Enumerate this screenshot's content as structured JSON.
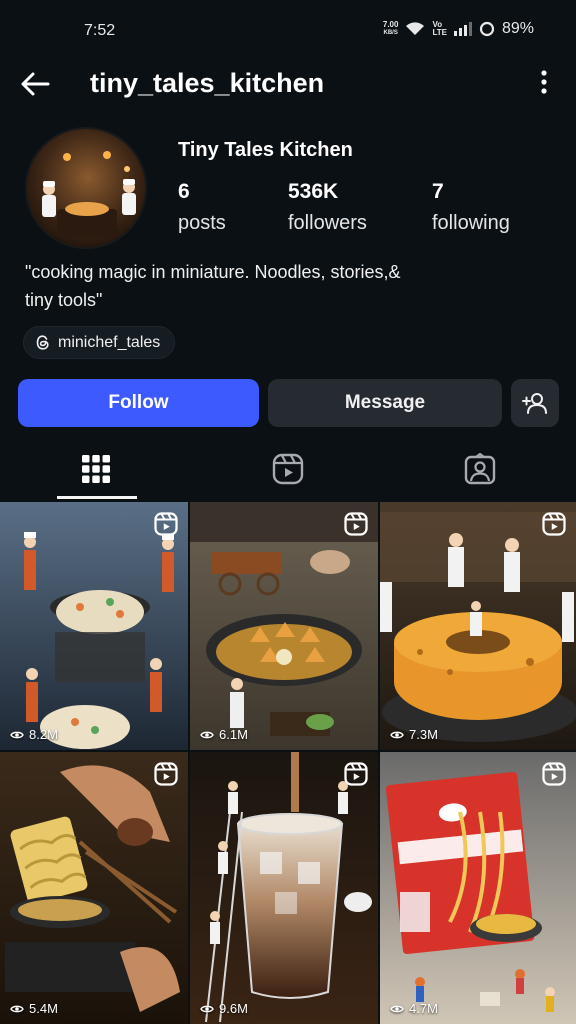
{
  "status_bar": {
    "time": "7:52",
    "net_speed_value": "7.00",
    "net_speed_unit": "KB/S",
    "volte_top": "Vo",
    "volte_bottom": "LTE",
    "battery": "89%"
  },
  "header": {
    "username": "tiny_tales_kitchen"
  },
  "profile": {
    "display_name": "Tiny Tales Kitchen",
    "stats": [
      {
        "value": "6",
        "label": "posts"
      },
      {
        "value": "536K",
        "label": "followers"
      },
      {
        "value": "7",
        "label": "following"
      }
    ],
    "bio_line1": "\"cooking magic in miniature. Noodles, stories,&",
    "bio_line2": "tiny tools\"",
    "threads_handle": "minichef_tales"
  },
  "actions": {
    "follow_label": "Follow",
    "message_label": "Message"
  },
  "tabs": [
    {
      "name": "grid-icon",
      "active": true
    },
    {
      "name": "reels-icon",
      "active": false
    },
    {
      "name": "tagged-icon",
      "active": false
    }
  ],
  "posts": [
    {
      "views": "8.2M",
      "icon": "reels-icon"
    },
    {
      "views": "6.1M",
      "icon": "reels-icon"
    },
    {
      "views": "7.3M",
      "icon": "reels-icon"
    },
    {
      "views": "5.4M",
      "icon": "reels-icon"
    },
    {
      "views": "9.6M",
      "icon": "reels-icon"
    },
    {
      "views": "4.7M",
      "icon": "reels-icon"
    }
  ],
  "colors": {
    "background": "#0b1014",
    "follow_button": "#3d5afe",
    "secondary_button": "#262b31"
  }
}
